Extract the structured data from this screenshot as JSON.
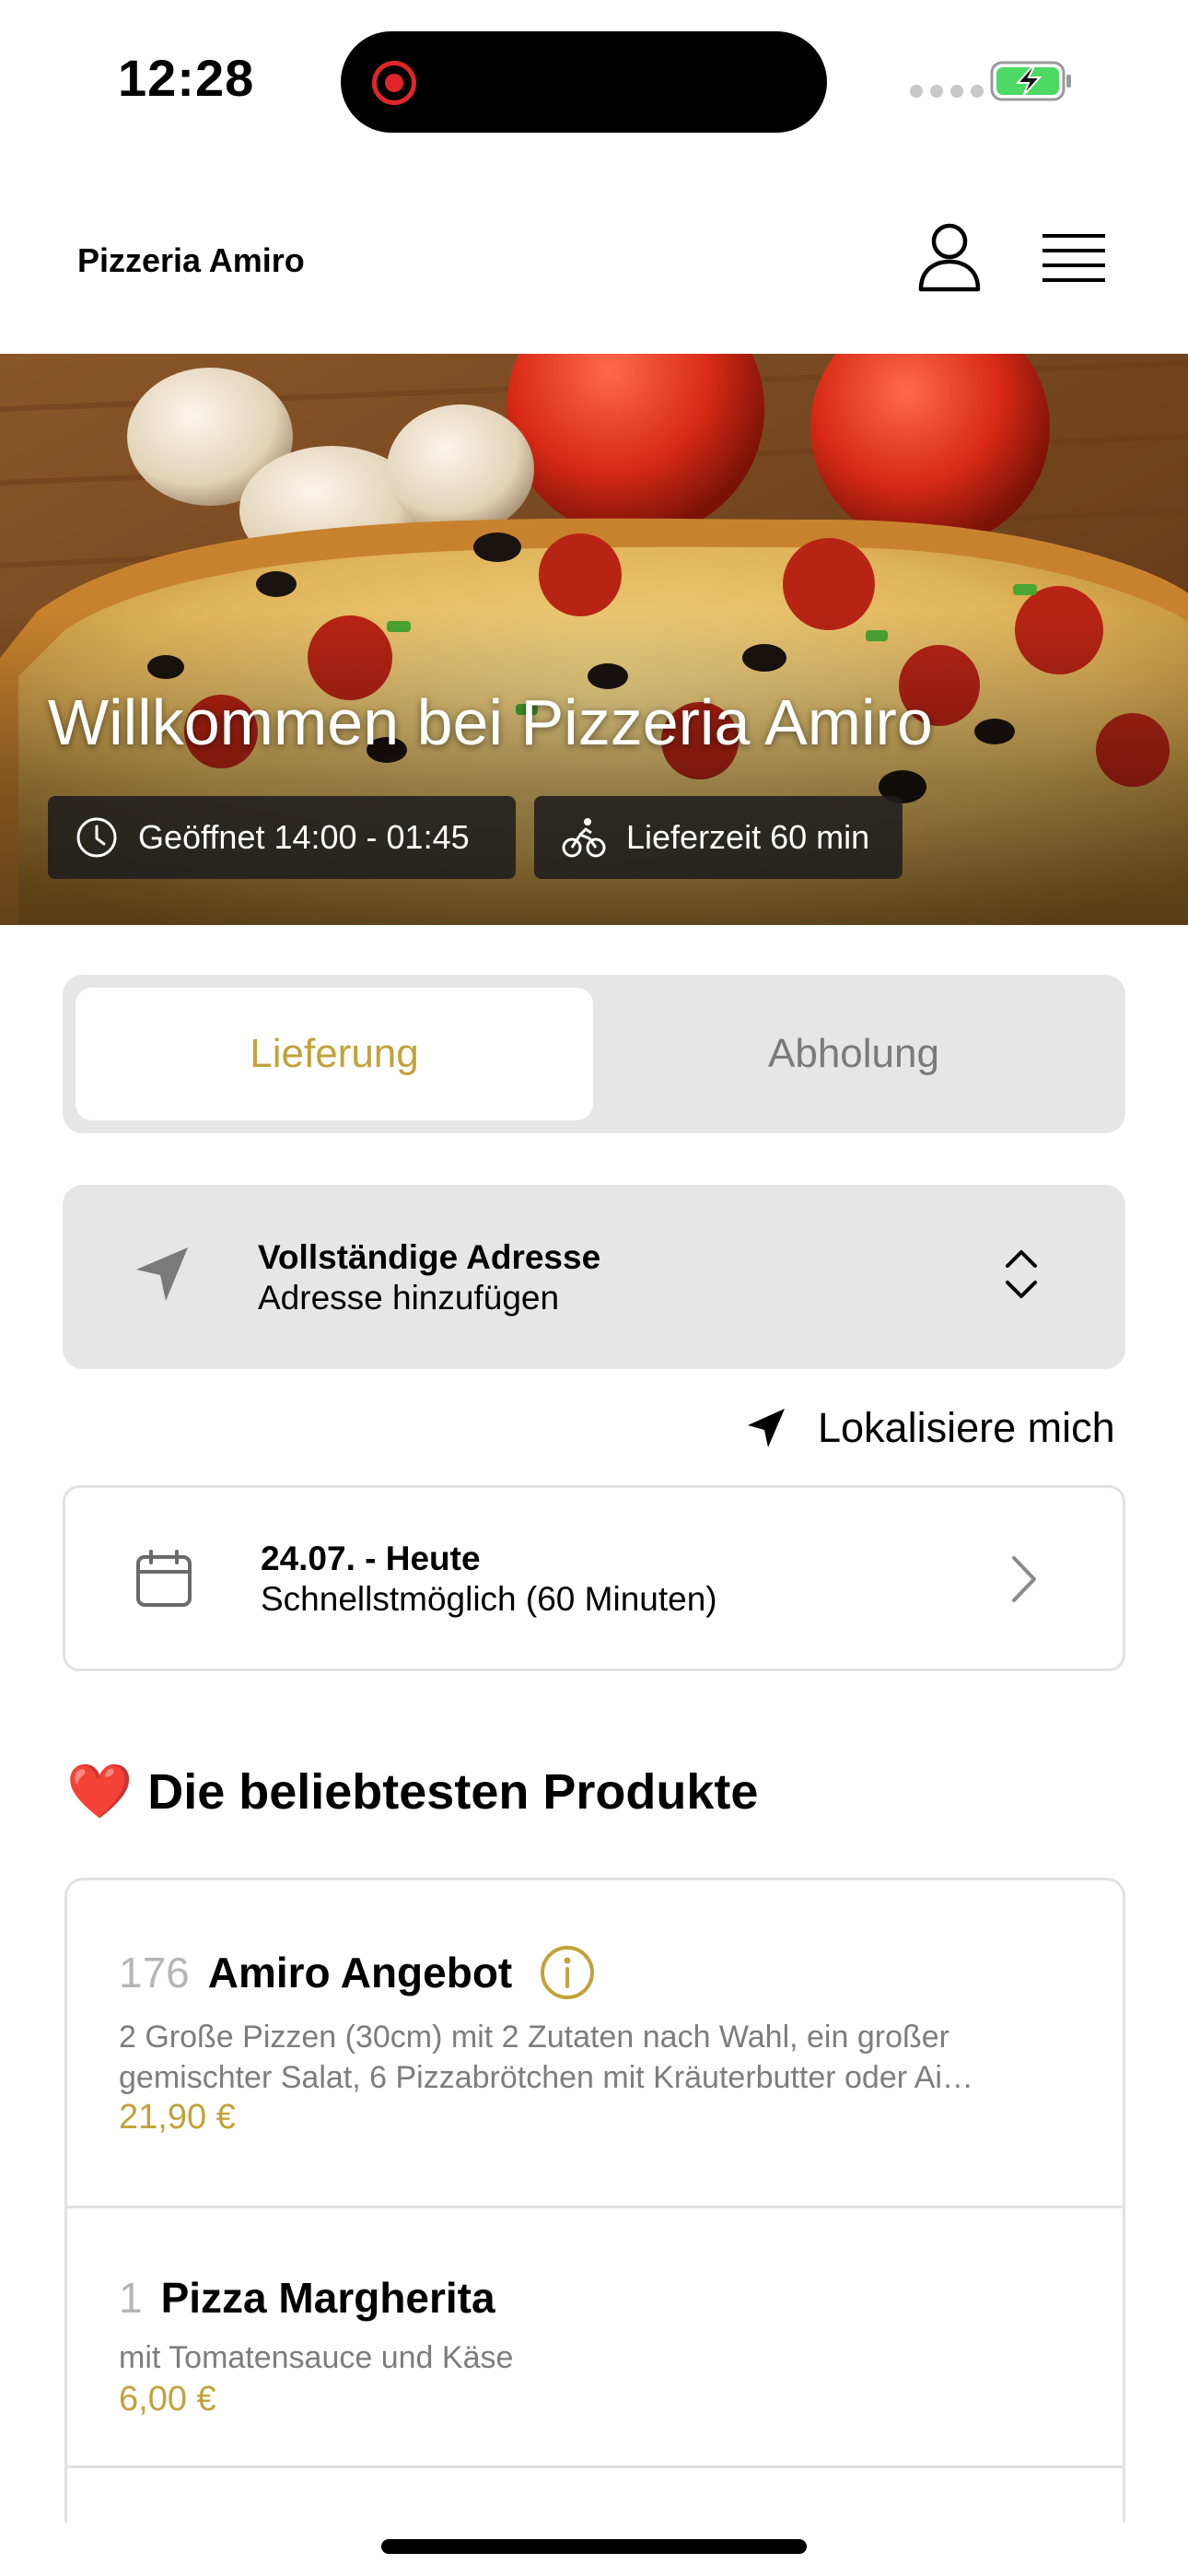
{
  "status_bar": {
    "time": "12:28"
  },
  "header": {
    "brand": "Pizzeria Amiro"
  },
  "hero": {
    "title": "Willkommen bei Pizzeria Amiro",
    "open_hours": "Geöffnet 14:00 - 01:45",
    "delivery_time": "Lieferzeit 60 min"
  },
  "order_mode": {
    "options": [
      "Lieferung",
      "Abholung"
    ],
    "selected": "Lieferung"
  },
  "address": {
    "title": "Vollständige Adresse",
    "subtitle": "Adresse hinzufügen",
    "locate_label": "Lokalisiere mich"
  },
  "schedule": {
    "title": "24.07. - Heute",
    "subtitle": "Schnellstmöglich (60 Minuten)"
  },
  "popular": {
    "heading_emoji": "❤️",
    "heading": "Die beliebtesten Produkte",
    "items": [
      {
        "number": "176",
        "name": "Amiro Angebot",
        "description": "2 Große Pizzen (30cm) mit 2 Zutaten nach Wahl, ein großer gemischter Salat, 6 Pizzabrötchen mit Kräuterbutter oder Ai…",
        "price": "21,90 €"
      },
      {
        "number": "1",
        "name": "Pizza Margherita",
        "description": "mit Tomatensauce und Käse",
        "price": "6,00 €"
      }
    ]
  },
  "colors": {
    "accent": "#c2a23a",
    "segment_bg": "#e6e6e6",
    "muted_text": "#7d7d7d",
    "battery_green": "#4cd964",
    "record_red": "#e0262a"
  },
  "icons": [
    "user-icon",
    "menu-icon",
    "clock-icon",
    "bicycle-icon",
    "location-arrow-icon",
    "updown-chevron-icon",
    "navigation-arrow-icon",
    "calendar-icon",
    "chevron-right-icon",
    "info-icon"
  ]
}
